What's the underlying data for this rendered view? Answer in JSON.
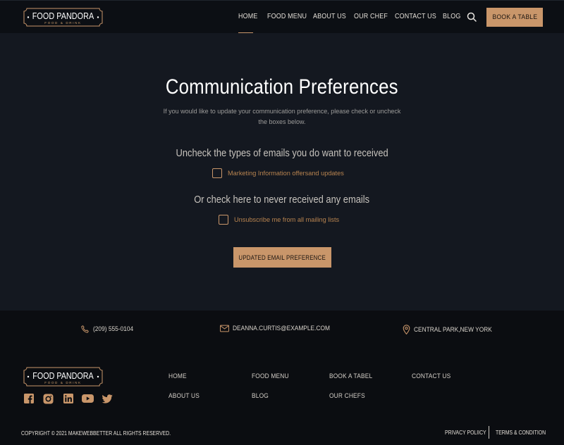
{
  "brand": {
    "name": "FOOD PANDORA",
    "tagline": "FOOD & DRINK",
    "accent_color": "#c9966a"
  },
  "header": {
    "nav": [
      {
        "label": "HOME",
        "active": true
      },
      {
        "label": "FOOD MENU",
        "active": false
      },
      {
        "label": "ABOUT US",
        "active": false
      },
      {
        "label": "OUR CHEF",
        "active": false
      },
      {
        "label": "CONTACT US",
        "active": false
      },
      {
        "label": "BLOG",
        "active": false
      }
    ],
    "search_icon": "search-icon",
    "cta_label": "BOOK A TABLE"
  },
  "main": {
    "title": "Communication Preferences",
    "description": "If you would like to update your communication preference, please check or uncheck the boxes below.",
    "section1_heading": "Uncheck the types of emails you do want to received",
    "option1_label": "Marketing Information offersand updates",
    "option1_checked": false,
    "section2_heading": "Or check here to never received any emails",
    "option2_label": "Unsubscribe me from all mailing lists",
    "option2_checked": false,
    "submit_label": "UPDATED EMAIL PREFERENCE"
  },
  "footer": {
    "contacts": {
      "phone": "(209) 555-0104",
      "email": "DEANNA.CURTIS@EXAMPLE.COM",
      "location": "CENTRAL PARK,NEW YORK"
    },
    "socials": [
      "facebook-icon",
      "instagram-icon",
      "linkedin-icon",
      "youtube-icon",
      "twitter-icon"
    ],
    "links": {
      "home": "HOME",
      "food_menu": "FOOD MENU",
      "book_table": "BOOK A TABEL",
      "contact_us": "CONTACT US",
      "about_us": "ABOUT US",
      "blog": "BLOG",
      "our_chefs": "OUR CHEFS"
    },
    "copyright": "COPYRIGHT © 2021 MAKEWEBBETTER ALL RIGHTS RESERVED.",
    "privacy": "PRIVACY POLIICY",
    "terms": "TERMS & CONDITION"
  }
}
